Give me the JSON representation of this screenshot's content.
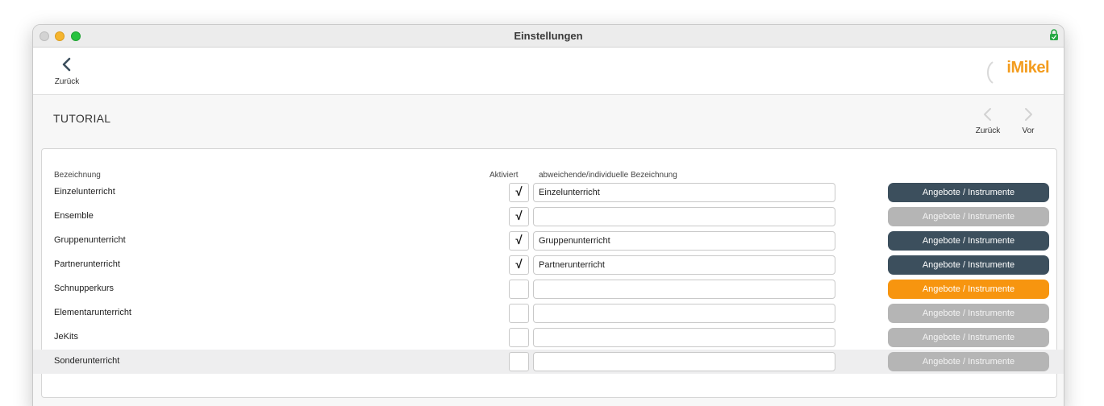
{
  "window": {
    "title": "Einstellungen"
  },
  "topbar": {
    "back_label": "Zurück",
    "logo_text": "iMikel"
  },
  "section": {
    "title": "TUTORIAL",
    "prev_label": "Zurück",
    "next_label": "Vor"
  },
  "table": {
    "headers": {
      "name": "Bezeichnung",
      "active": "Aktiviert",
      "custom": "abweichende/individuelle Bezeichnung"
    },
    "rows": [
      {
        "label": "Einzelunterricht",
        "checked": true,
        "check_mark": "√",
        "custom_value": "Einzelunterricht",
        "button_label": "Angebote / Instrumente",
        "button_state": "active"
      },
      {
        "label": "Ensemble",
        "checked": true,
        "check_mark": "√",
        "custom_value": "",
        "button_label": "Angebote / Instrumente",
        "button_state": "inactive"
      },
      {
        "label": "Gruppenunterricht",
        "checked": true,
        "check_mark": "√",
        "custom_value": "Gruppenunterricht",
        "button_label": "Angebote / Instrumente",
        "button_state": "active"
      },
      {
        "label": "Partnerunterricht",
        "checked": true,
        "check_mark": "√",
        "custom_value": "Partnerunterricht",
        "button_label": "Angebote / Instrumente",
        "button_state": "active"
      },
      {
        "label": "Schnupperkurs",
        "checked": false,
        "check_mark": "",
        "custom_value": "",
        "button_label": "Angebote / Instrumente",
        "button_state": "highlight"
      },
      {
        "label": "Elementarunterricht",
        "checked": false,
        "check_mark": "",
        "custom_value": "",
        "button_label": "Angebote / Instrumente",
        "button_state": "inactive"
      },
      {
        "label": "JeKits",
        "checked": false,
        "check_mark": "",
        "custom_value": "",
        "button_label": "Angebote / Instrumente",
        "button_state": "inactive"
      },
      {
        "label": "Sonderunterricht",
        "checked": false,
        "check_mark": "",
        "custom_value": "",
        "button_label": "Angebote / Instrumente",
        "button_state": "inactive",
        "selected": true
      }
    ]
  },
  "colors": {
    "button_active": "#3c4f5d",
    "button_inactive": "#b5b5b5",
    "button_highlight": "#f7950f",
    "logo": "#f39c1e"
  },
  "icons": {
    "back": "chevron-left-icon",
    "prev": "chevron-left-icon",
    "next": "chevron-right-icon",
    "lock": "lock-icon"
  }
}
